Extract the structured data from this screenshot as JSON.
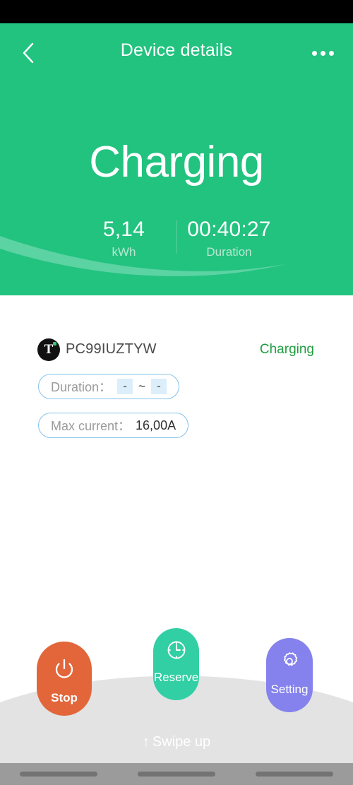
{
  "header": {
    "title": "Device details",
    "back_icon": "chevron-left-icon",
    "more_icon": "overflow-dots-icon"
  },
  "hero": {
    "status": "Charging",
    "stats": [
      {
        "value": "5,14",
        "label": "kWh"
      },
      {
        "value": "00:40:27",
        "label": "Duration"
      }
    ]
  },
  "device": {
    "logo_letter": "T",
    "name": "PC99IUZTYW",
    "status": "Charging"
  },
  "chips": {
    "duration": {
      "label": "Duration：",
      "start": "-",
      "separator": "~",
      "end": "-"
    },
    "max_current": {
      "label": "Max current：",
      "value": "16,00A"
    }
  },
  "actions": [
    {
      "label": "Stop",
      "icon": "power-icon",
      "color": "#e2663a"
    },
    {
      "label": "Reserve",
      "icon": "clock-icon",
      "color": "#32cfa4"
    },
    {
      "label": "Setting",
      "icon": "gear-icon",
      "color": "#8582ed"
    }
  ],
  "footer": {
    "arrow": "↑",
    "swipe_label": "Swipe up"
  },
  "colors": {
    "brand_green": "#22c27f",
    "status_green": "#1f9d3f",
    "chip_border": "#85c3ea",
    "panel_gray": "#e3e3e3"
  }
}
